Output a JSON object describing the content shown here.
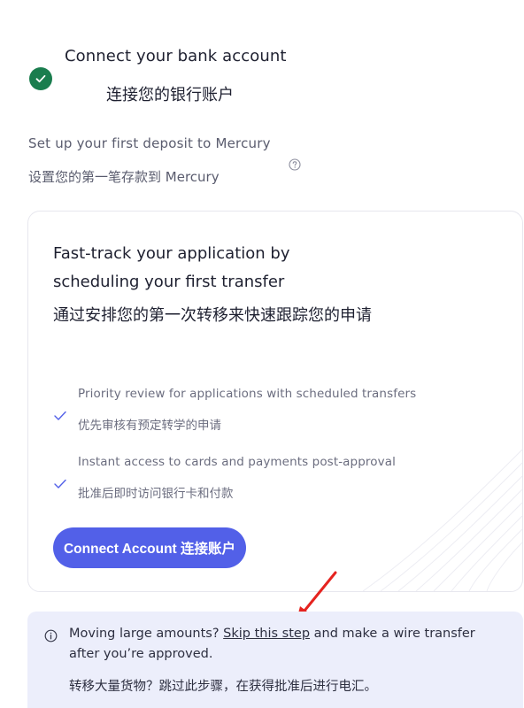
{
  "step": {
    "title": "Connect your bank account",
    "title_zh": "连接您的银行账户",
    "status_icon": "check-circle-icon"
  },
  "subtitle": {
    "text": "Set up your first deposit to Mercury",
    "text_zh": "设置您的第一笔存款到 Mercury",
    "help_icon": "question-circle-icon"
  },
  "card": {
    "title": "Fast-track your application by scheduling your first transfer",
    "title_zh": "通过安排您的第一次转移来快速跟踪您的申请",
    "benefits": [
      {
        "text": "Priority review for applications with scheduled transfers",
        "text_zh": "优先审核有预定转学的申请"
      },
      {
        "text": "Instant access to cards and payments post-approval",
        "text_zh": "批准后即时访问银行卡和付款"
      }
    ],
    "button_label": "Connect Account 连接账户"
  },
  "notice": {
    "prefix": "Moving large amounts? ",
    "link": "Skip this step",
    "suffix": " and make a wire transfer",
    "line2": "after you’re approved.",
    "text_zh": "转移大量货物？跳过此步骤，在获得批准后进行电汇。",
    "icon": "info-circle-icon"
  },
  "colors": {
    "accent": "#5260e8",
    "success": "#1a7d4e",
    "notice_bg": "#eceefb",
    "annotation_arrow": "#e5231f"
  }
}
